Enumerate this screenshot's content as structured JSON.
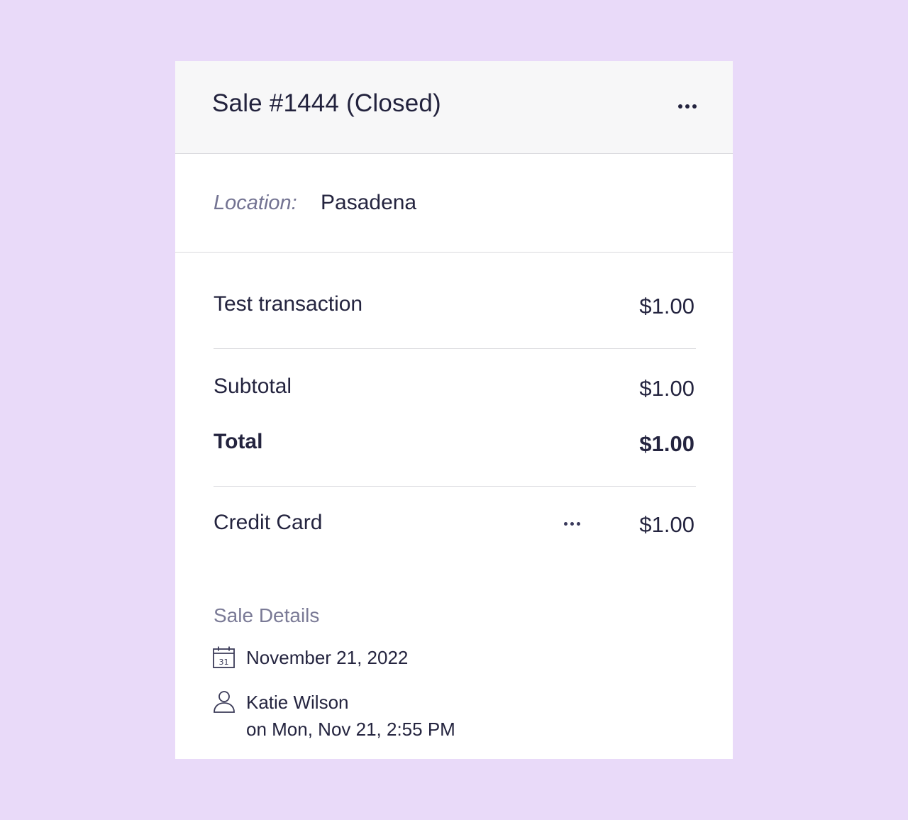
{
  "sale": {
    "title": "Sale #1444 (Closed)",
    "more_icon": "more-horizontal-icon"
  },
  "location": {
    "label": "Location:",
    "value": "Pasadena"
  },
  "line_items": [
    {
      "label": "Test transaction",
      "amount": "$1.00"
    }
  ],
  "totals": {
    "subtotal_label": "Subtotal",
    "subtotal_amount": "$1.00",
    "total_label": "Total",
    "total_amount": "$1.00"
  },
  "payments": [
    {
      "method": "Credit Card",
      "amount": "$1.00",
      "more_icon": "more-horizontal-icon"
    }
  ],
  "sale_details": {
    "title": "Sale Details",
    "date_icon": "calendar-icon",
    "date": "November 21, 2022",
    "user_icon": "user-icon",
    "user": "Katie Wilson",
    "timestamp": "on Mon, Nov 21, 2:55 PM"
  }
}
